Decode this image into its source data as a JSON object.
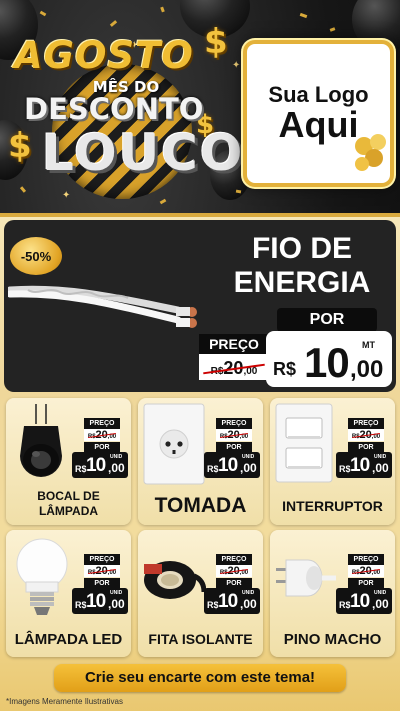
{
  "header": {
    "title_word": "AGOSTO",
    "subtitle": "MÊS DO",
    "title_desconto": "DESCONTO",
    "title_louco": "LOUCO",
    "dollar_sign": "$",
    "logo_line1": "Sua Logo",
    "logo_line2": "Aqui"
  },
  "hero": {
    "discount_badge": "-50%",
    "title": "FIO DE ENERGIA",
    "preco_label": "PREÇO",
    "old_currency": "R$",
    "old_price": "20",
    "old_cents": ",00",
    "por_label": "POR",
    "currency": "R$",
    "price_int": "10",
    "price_dec": ",00",
    "unit": "MT"
  },
  "products": [
    {
      "name": "BOCAL DE LÂMPADA",
      "preco_label": "PREÇO",
      "old_currency": "R$",
      "old_price": "20",
      "old_cents": ",00",
      "por_label": "POR",
      "currency": "R$",
      "price_int": "10",
      "price_dec": ",00",
      "unit": "UNID"
    },
    {
      "name": "TOMADA",
      "preco_label": "PREÇO",
      "old_currency": "R$",
      "old_price": "20",
      "old_cents": ",00",
      "por_label": "POR",
      "currency": "R$",
      "price_int": "10",
      "price_dec": ",00",
      "unit": "UNID"
    },
    {
      "name": "INTERRUPTOR",
      "preco_label": "PREÇO",
      "old_currency": "R$",
      "old_price": "20",
      "old_cents": ",00",
      "por_label": "POR",
      "currency": "R$",
      "price_int": "10",
      "price_dec": ",00",
      "unit": "UNID"
    },
    {
      "name": "LÂMPADA LED",
      "preco_label": "PREÇO",
      "old_currency": "R$",
      "old_price": "20",
      "old_cents": ",00",
      "por_label": "POR",
      "currency": "R$",
      "price_int": "10",
      "price_dec": ",00",
      "unit": "UNID"
    },
    {
      "name": "FITA ISOLANTE",
      "preco_label": "PREÇO",
      "old_currency": "R$",
      "old_price": "20",
      "old_cents": ",00",
      "por_label": "POR",
      "currency": "R$",
      "price_int": "10",
      "price_dec": ",00",
      "unit": "UNID"
    },
    {
      "name": "PINO MACHO",
      "preco_label": "PREÇO",
      "old_currency": "R$",
      "old_price": "20",
      "old_cents": ",00",
      "por_label": "POR",
      "currency": "R$",
      "price_int": "10",
      "price_dec": ",00",
      "unit": "UNID"
    }
  ],
  "footer": {
    "cta": "Crie seu encarte com este tema!",
    "disclaimer": "*Imagens Meramente Ilustrativas"
  },
  "colors": {
    "gold": "#e2a424",
    "dark": "#232323",
    "cream": "#f6e7b8"
  }
}
